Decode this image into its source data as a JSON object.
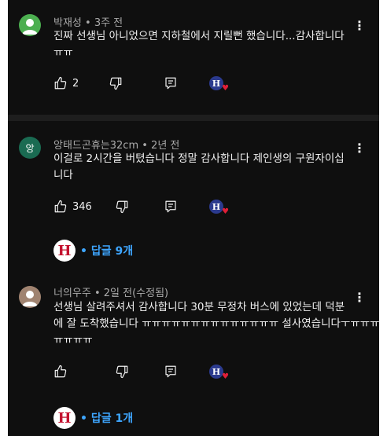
{
  "comments": [
    {
      "avatar_color": "#4caf50",
      "avatar_icon": "default-user-icon",
      "meta": "박재성 • 3주 전",
      "lines": [
        "진짜 선생님 아니었으면 지하철에서 지릴뻔 했습니다...감사합니다",
        "ㅠㅠ"
      ],
      "likes": "2",
      "creator_badge": "H"
    },
    {
      "avatar_color": "#1a6b52",
      "avatar_letter": "앙",
      "meta": "앙태드곤휴는32cm • 2년 전",
      "lines": [
        "이걸로 2시간을 버텼습니다 정말 감사합니다 제인생의 구원자이십",
        "니다"
      ],
      "likes": "346",
      "creator_badge": "H",
      "replies_label": "• 답글 9개",
      "replies_badge": "H"
    },
    {
      "avatar_color": "#a08370",
      "avatar_icon": "default-user-icon",
      "meta": "너의우주 • 2일 전(수정됨)",
      "lines": [
        "선생님 살려주셔서 감사합니다 30분 무정차 버스에 있었는데 덕분",
        "에 잘 도착했습니다 ㅠㅠㅠㅠㅠㅠㅠㅠㅠㅠㅠㅠㅠㅠ 설사였습니다ㅜㅠㅠㅠ",
        "ㅠㅠㅠㅠ"
      ],
      "likes": "",
      "creator_badge": "H",
      "replies_label": "• 답글 1개",
      "replies_badge": "H"
    }
  ],
  "menu_glyph": "⋮",
  "heart_glyph": "♥"
}
